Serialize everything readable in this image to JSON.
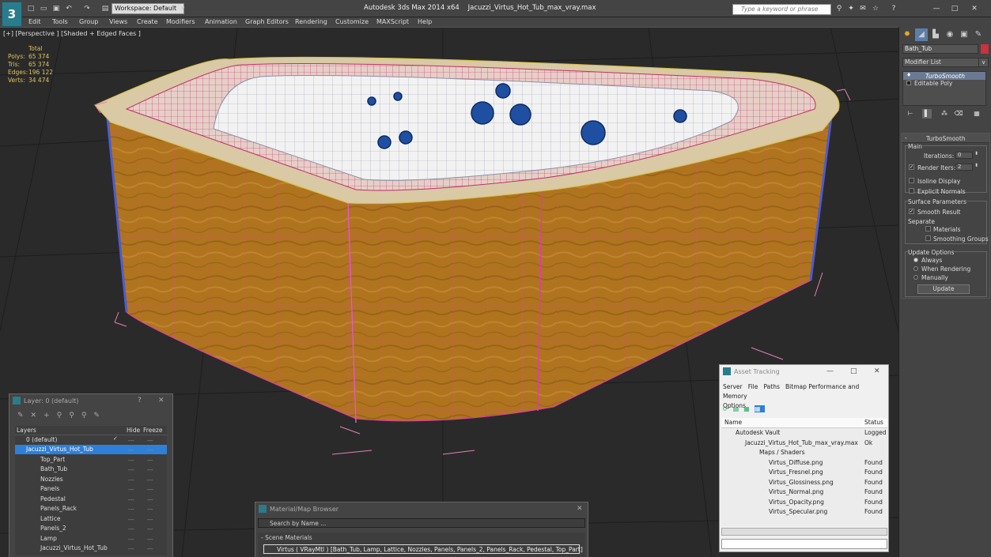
{
  "app": {
    "title": "Autodesk 3ds Max  2014 x64",
    "file": "Jacuzzi_Virtus_Hot_Tub_max_vray.max",
    "logo": "3",
    "workspace": "Workspace: Default",
    "search_placeholder": "Type a keyword or phrase"
  },
  "menu": [
    "Edit",
    "Tools",
    "Group",
    "Views",
    "Create",
    "Modifiers",
    "Animation",
    "Graph Editors",
    "Rendering",
    "Customize",
    "MAXScript",
    "Help"
  ],
  "viewport": {
    "label": "[+] [Perspective ] [Shaded + Edged Faces ]",
    "stats_header": "Total",
    "stats": [
      {
        "key": "Polys:",
        "value": "65 374"
      },
      {
        "key": "Tris:",
        "value": "65 374"
      },
      {
        "key": "Edges:",
        "value": "196 122"
      },
      {
        "key": "Verts:",
        "value": "34 474"
      }
    ],
    "colors": {
      "wood": "#b0741f",
      "rim": "#d9c9a4",
      "wire": "#e13ab5",
      "jets": "#1f4fa0",
      "bg": "#2a2a2a"
    }
  },
  "command_panel": {
    "object_name": "Bath_Tub",
    "object_color": "#c8333c",
    "modifier_list": "Modifier List",
    "stack": [
      "TurboSmooth",
      "Editable Poly"
    ],
    "rollout": "TurboSmooth",
    "main_label": "Main",
    "iterations_label": "Iterations:",
    "iterations_value": "0",
    "render_iters_label": "Render Iters:",
    "render_iters_value": "2",
    "isoline": "Isoline Display",
    "explicit": "Explicit Normals",
    "surface_params": "Surface Parameters",
    "smooth_result": "Smooth Result",
    "separate": "Separate",
    "materials": "Materials",
    "smoothing_groups": "Smoothing Groups",
    "update_options": "Update Options",
    "always": "Always",
    "when_rendering": "When Rendering",
    "manually": "Manually",
    "update_btn": "Update"
  },
  "layers": {
    "title": "Layer: 0 (default)",
    "col_layers": "Layers",
    "col_hide": "Hide",
    "col_freeze": "Freeze",
    "rows": [
      "0 (default)",
      "Jacuzzi_Virtus_Hot_Tub",
      "Top_Part",
      "Bath_Tub",
      "Nozzles",
      "Panels",
      "Pedestal",
      "Panels_Rack",
      "Lattice",
      "Panels_2",
      "Lamp",
      "Jacuzzi_Virtus_Hot_Tub"
    ]
  },
  "asset_tracking": {
    "title": "Asset Tracking",
    "menu": [
      "Server",
      "File",
      "Paths",
      "Bitmap Performance and Memory",
      "Options"
    ],
    "col_name": "Name",
    "col_status": "Status",
    "rows": [
      {
        "name": "Autodesk Vault",
        "status": "Logged"
      },
      {
        "name": "Jacuzzi_Virtus_Hot_Tub_max_vray.max",
        "status": "Ok"
      },
      {
        "name": "Maps / Shaders",
        "status": ""
      },
      {
        "name": "Virtus_Diffuse.png",
        "status": "Found"
      },
      {
        "name": "Virtus_Fresnel.png",
        "status": "Found"
      },
      {
        "name": "Virtus_Glossiness.png",
        "status": "Found"
      },
      {
        "name": "Virtus_Normal.png",
        "status": "Found"
      },
      {
        "name": "Virtus_Opacity.png",
        "status": "Found"
      },
      {
        "name": "Virtus_Specular.png",
        "status": "Found"
      }
    ]
  },
  "material_browser": {
    "title": "Material/Map Browser",
    "search": "Search by Name ...",
    "group": "- Scene Materials",
    "item": "Virtus  ( VRayMtl ) [Bath_Tub, Lamp, Lattice, Nozzles, Panels, Panels_2, Panels_Rack, Pedestal, Top_Part]"
  }
}
